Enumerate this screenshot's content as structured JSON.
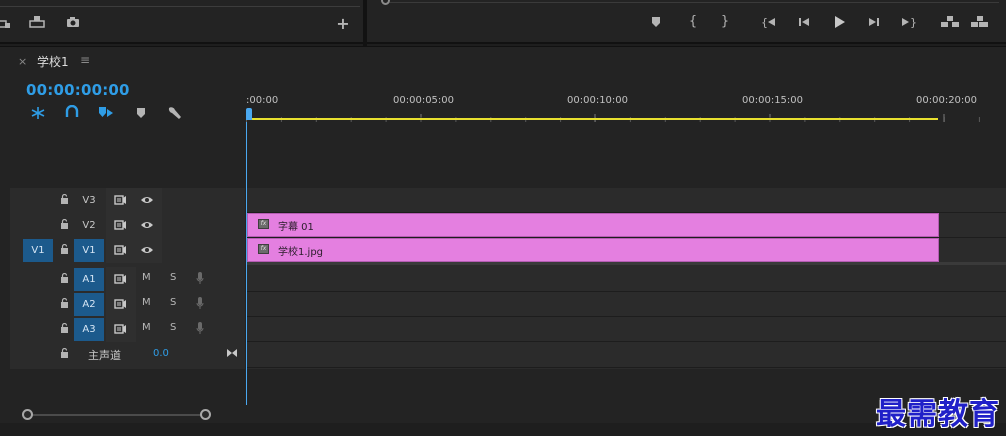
{
  "source_monitor": {
    "buttons": [
      {
        "name": "insert-icon"
      },
      {
        "name": "export-frame-icon"
      },
      {
        "name": "camera-icon"
      },
      {
        "name": "add-button-icon",
        "label": "+"
      }
    ]
  },
  "program_monitor": {
    "buttons": [
      {
        "name": "add-marker-icon"
      },
      {
        "name": "mark-in-icon",
        "label": "{"
      },
      {
        "name": "mark-out-icon",
        "label": "}"
      },
      {
        "name": "go-to-in-icon"
      },
      {
        "name": "step-back-icon"
      },
      {
        "name": "play-icon"
      },
      {
        "name": "step-forward-icon"
      },
      {
        "name": "go-to-out-icon"
      },
      {
        "name": "lift-icon"
      },
      {
        "name": "extract-icon"
      }
    ]
  },
  "timeline": {
    "tab": {
      "close": "×",
      "title": "学校1",
      "menu": "≡"
    },
    "timecode": "00:00:00:00",
    "tools": [
      {
        "name": "snap-icon"
      },
      {
        "name": "linked-selection-icon"
      },
      {
        "name": "add-marker-icon"
      },
      {
        "name": "marker-icon"
      },
      {
        "name": "wrench-icon"
      }
    ],
    "ruler_labels": [
      ":00:00",
      "00:00:05:00",
      "00:00:10:00",
      "00:00:15:00",
      "00:00:20:00"
    ],
    "video_tracks": [
      {
        "source": "",
        "name": "V3",
        "active": false
      },
      {
        "source": "",
        "name": "V2",
        "active": false
      },
      {
        "source": "V1",
        "name": "V1",
        "active": true
      }
    ],
    "audio_tracks": [
      {
        "name": "A1",
        "m": "M",
        "s": "S"
      },
      {
        "name": "A2",
        "m": "M",
        "s": "S"
      },
      {
        "name": "A3",
        "m": "M",
        "s": "S"
      }
    ],
    "master": {
      "label": "主声道",
      "value": "0.0"
    },
    "clips": [
      {
        "label": "字幕 01",
        "track": "V2",
        "color": "#e47fe0"
      },
      {
        "label": "学校1.jpg",
        "track": "V1",
        "color": "#e47fe0"
      }
    ]
  },
  "watermark": "最需教育",
  "colors": {
    "accent": "#2f9de6",
    "clip": "#e47fe0",
    "work_area": "#e8e02f",
    "track_selected": "#1c5a8c"
  }
}
